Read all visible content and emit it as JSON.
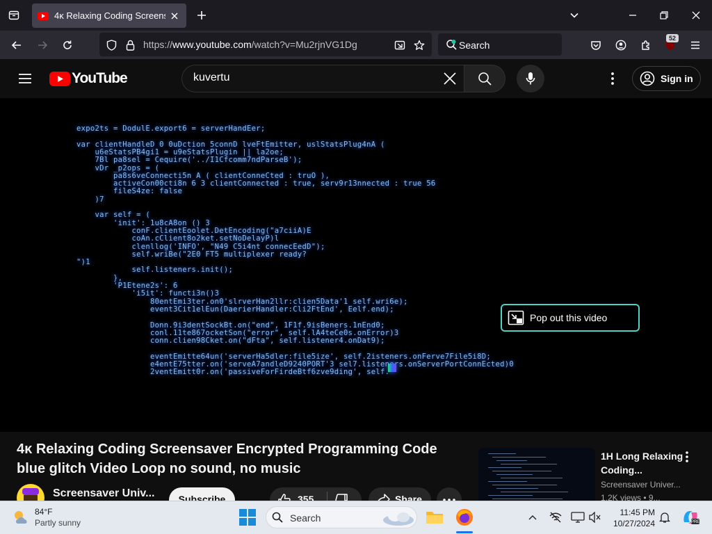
{
  "browser": {
    "tab_title": "4κ Relaxing Coding Screensaver Encrypted Programming Code blue glitch Video Loop no sound, no music",
    "url_prefix": "https://",
    "url_host": "www.youtube.com",
    "url_path": "/watch?v=Mu2rjnVG1Dg",
    "search_placeholder": "Search",
    "extension_badge": "52"
  },
  "youtube": {
    "logo_text": "YouTube",
    "search_query": "kuvertu",
    "sign_in_label": "Sign in"
  },
  "video": {
    "popout_label": "Pop out this video",
    "code_lines": [
      "expo2ts = DodulE.export6 = serverHandEer;",
      "",
      "var clientHandleD 0 0uDction 5connD lveFtEmitter, uslStatsPlug4nA (",
      "    u6eStatsPB4gi1 = u9eStatsPlugin || la2oe;",
      "    7Bl pa8sel = Cequire('../I1Cfcomm7ndParseB');",
      "    vDr _p2ops = (",
      "        pa8s6veConnecti5n A ( clientConneCted : truO ),",
      "        activeCon00cti8n 6 3 clientConnected : true, serv9r13nnected : true 56",
      "        fileS4ze: false",
      "    )7",
      "",
      "    var self = (",
      "        'init': 1u8cA8on () 3",
      "            conF.clientEoolet.DetEncoding(\"a7ciiA)E",
      "            coAn.cClient8o2ket.setNoDelayP)l",
      "            clenllog('INFO', \"N49 C5i4nt connecEedD\");",
      "            self.wriBe(\"2E0 FT5 multiplexer ready?",
      "\")1",
      "            self.listeners.init();",
      "        },",
      "        'P1Etene2s': 6",
      "            'i5it': functi3n()3",
      "                80entEmi3ter.on0'slrverHan2llr:clien5Data'1 self.wri6e);",
      "                event3Cit1elEun(DaerierHandler:Cli2FtEnd', Eelf.end);",
      "",
      "                Donn.9i3dentSockBt.on(\"end\", 1F1f.9isBeners.1nEnd0;",
      "                conl.11te867ocketSon(\"error\", self.lA4teCe0s.onError)3",
      "                conn.clien98Cket.on(\"dFta\", self.listener4.onDat9);",
      "",
      "                eventEmitte64un('serverHa5dler:file5ize', self.2isteners.onFerve7File5i8D;",
      "                e4entE75tter.on('serveA7andleD9240PORT'3 sel7.listeners.onServerPortConnEcted)0",
      "                2ventEmitt0r.on('passiveForFirdeBtf6zve9ding', self."
    ]
  },
  "watch": {
    "title": "4κ Relaxing Coding Screensaver Encrypted Programming Code blue glitch Video Loop no sound, no music",
    "channel_name": "Screensaver Univ...",
    "subscribe_label": "Subscribe",
    "like_count": "355",
    "share_label": "Share"
  },
  "recommended": {
    "title": "1H Long Relaxing Coding...",
    "channel": "Screensaver Univer...",
    "views": "1.2K views • 9..."
  },
  "taskbar": {
    "weather_temp": "84°F",
    "weather_condition": "Partly sunny",
    "search_label": "Search",
    "time": "11:45 PM",
    "date": "10/27/2024"
  }
}
